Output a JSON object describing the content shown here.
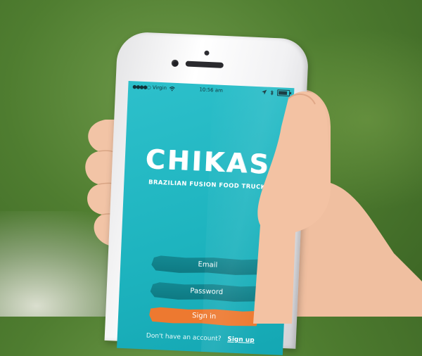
{
  "status_bar": {
    "signal_dots": "●●●●○",
    "carrier": "Virgin",
    "time": "10:56 am",
    "battery_level": 0.85,
    "icons": [
      "wifi-icon",
      "location-arrow-icon",
      "bluetooth-icon",
      "battery-icon"
    ]
  },
  "brand": {
    "logo_text": "CHIKAS",
    "tagline": "BRAZILIAN FUSION FOOD TRUCK"
  },
  "login": {
    "email_placeholder": "Email",
    "password_placeholder": "Password",
    "signin_label": "Sign in"
  },
  "signup": {
    "prompt": "Don't have an account?",
    "link_label": "Sign up"
  },
  "colors": {
    "screen_bg": "#1eb4bf",
    "field_bg": "#117d86",
    "signin_bg": "#ed7930",
    "text": "#ffffff"
  }
}
